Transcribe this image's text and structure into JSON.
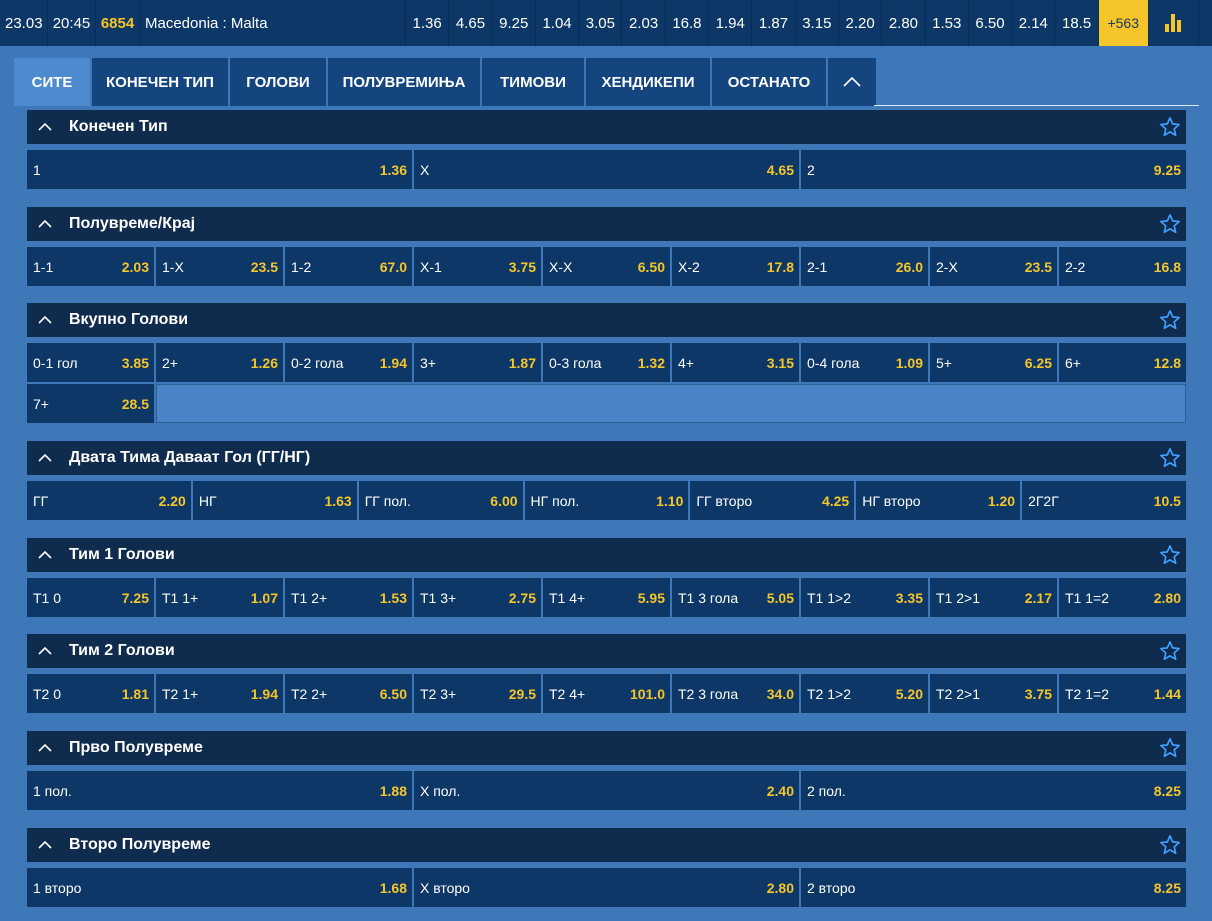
{
  "topbar": {
    "date": "23.03",
    "time": "20:45",
    "code": "6854",
    "match": "Macedonia : Malta",
    "odds": [
      "1.36",
      "4.65",
      "9.25",
      "1.04",
      "3.05",
      "2.03",
      "16.8",
      "1.94",
      "1.87",
      "3.15",
      "2.20",
      "2.80",
      "1.53",
      "6.50",
      "2.14",
      "18.5"
    ],
    "more": "+563",
    "stats_icon": "bar-chart-icon"
  },
  "tabs": [
    "СИТЕ",
    "КОНЕЧЕН ТИП",
    "ГОЛОВИ",
    "ПОЛУВРЕМИЊА",
    "ТИМОВИ",
    "ХЕНДИКЕПИ",
    "ОСТАНАТО"
  ],
  "colors": {
    "accent": "#f6c52a",
    "dark": "#0c3766",
    "header": "#0f2b4e",
    "bg": "#3e78b8"
  },
  "sections": [
    {
      "title": "Конечен Тип",
      "rows": [
        [
          {
            "label": "1",
            "value": "1.36"
          },
          {
            "label": "X",
            "value": "4.65"
          },
          {
            "label": "2",
            "value": "9.25"
          }
        ]
      ]
    },
    {
      "title": "Полувреме/Крај",
      "rows": [
        [
          {
            "label": "1-1",
            "value": "2.03"
          },
          {
            "label": "1-X",
            "value": "23.5"
          },
          {
            "label": "1-2",
            "value": "67.0"
          },
          {
            "label": "X-1",
            "value": "3.75"
          },
          {
            "label": "X-X",
            "value": "6.50"
          },
          {
            "label": "X-2",
            "value": "17.8"
          },
          {
            "label": "2-1",
            "value": "26.0"
          },
          {
            "label": "2-X",
            "value": "23.5"
          },
          {
            "label": "2-2",
            "value": "16.8"
          }
        ]
      ]
    },
    {
      "title": "Вкупно Голови",
      "rows": [
        [
          {
            "label": "0-1 гол",
            "value": "3.85"
          },
          {
            "label": "2+",
            "value": "1.26"
          },
          {
            "label": "0-2 гола",
            "value": "1.94"
          },
          {
            "label": "3+",
            "value": "1.87"
          },
          {
            "label": "0-3 гола",
            "value": "1.32"
          },
          {
            "label": "4+",
            "value": "3.15"
          },
          {
            "label": "0-4 гола",
            "value": "1.09"
          },
          {
            "label": "5+",
            "value": "6.25"
          },
          {
            "label": "6+",
            "value": "12.8"
          }
        ],
        [
          {
            "label": "7+",
            "value": "28.5"
          }
        ]
      ]
    },
    {
      "title": "Двата Тима Даваат Гол (ГГ/НГ)",
      "rows": [
        [
          {
            "label": "ГГ",
            "value": "2.20"
          },
          {
            "label": "НГ",
            "value": "1.63"
          },
          {
            "label": "ГГ пол.",
            "value": "6.00"
          },
          {
            "label": "НГ пол.",
            "value": "1.10"
          },
          {
            "label": "ГГ второ",
            "value": "4.25"
          },
          {
            "label": "НГ второ",
            "value": "1.20"
          },
          {
            "label": "2Г2Г",
            "value": "10.5"
          }
        ]
      ]
    },
    {
      "title": "Тим 1 Голови",
      "rows": [
        [
          {
            "label": "Т1 0",
            "value": "7.25"
          },
          {
            "label": "Т1 1+",
            "value": "1.07"
          },
          {
            "label": "Т1 2+",
            "value": "1.53"
          },
          {
            "label": "Т1 3+",
            "value": "2.75"
          },
          {
            "label": "Т1 4+",
            "value": "5.95"
          },
          {
            "label": "Т1 3 гола",
            "value": "5.05"
          },
          {
            "label": "Т1 1>2",
            "value": "3.35"
          },
          {
            "label": "Т1 2>1",
            "value": "2.17"
          },
          {
            "label": "Т1 1=2",
            "value": "2.80"
          }
        ]
      ]
    },
    {
      "title": "Тим 2 Голови",
      "rows": [
        [
          {
            "label": "Т2 0",
            "value": "1.81"
          },
          {
            "label": "Т2 1+",
            "value": "1.94"
          },
          {
            "label": "Т2 2+",
            "value": "6.50"
          },
          {
            "label": "Т2 3+",
            "value": "29.5"
          },
          {
            "label": "Т2 4+",
            "value": "101.0"
          },
          {
            "label": "Т2 3 гола",
            "value": "34.0"
          },
          {
            "label": "Т2 1>2",
            "value": "5.20"
          },
          {
            "label": "Т2 2>1",
            "value": "3.75"
          },
          {
            "label": "Т2 1=2",
            "value": "1.44"
          }
        ]
      ]
    },
    {
      "title": "Прво Полувреме",
      "rows": [
        [
          {
            "label": "1 пол.",
            "value": "1.88"
          },
          {
            "label": "X пол.",
            "value": "2.40"
          },
          {
            "label": "2 пол.",
            "value": "8.25"
          }
        ]
      ]
    },
    {
      "title": "Второ Полувреме",
      "rows": [
        [
          {
            "label": "1 второ",
            "value": "1.68"
          },
          {
            "label": "X второ",
            "value": "2.80"
          },
          {
            "label": "2 второ",
            "value": "8.25"
          }
        ]
      ]
    }
  ]
}
